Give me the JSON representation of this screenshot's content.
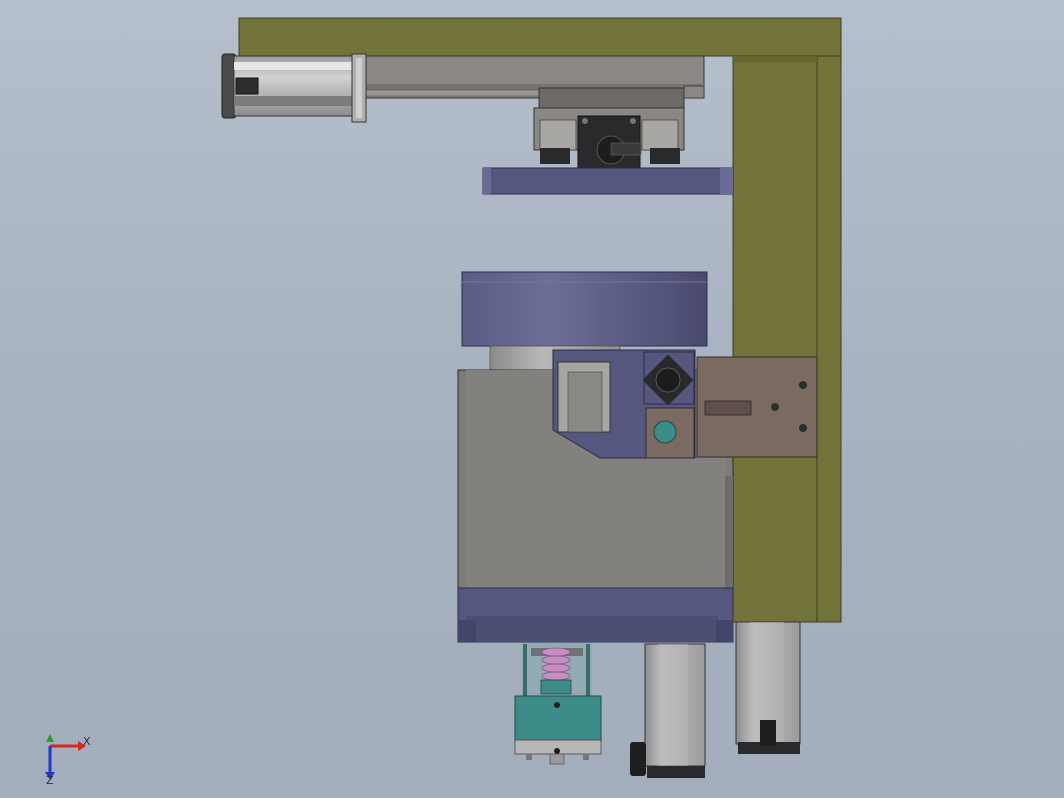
{
  "viewport": {
    "background_top": "#b6bfcc",
    "background_bottom": "#a3adbb"
  },
  "colors": {
    "frame_olive": "#727338",
    "frame_olive_dark": "#5f6030",
    "plate_blue": "#56577f",
    "plate_blue_dark": "#45466a",
    "body_gray": "#7d7b77",
    "motor_gray": "#a7a7a8",
    "teal": "#3c8c89",
    "bracket_brown": "#7a6a62",
    "spring_pink": "#c88fc4"
  },
  "triad": {
    "x_label": "X",
    "z_label": "Z",
    "x_color": "#d22a1f",
    "y_color": "#2aa12c",
    "z_color": "#2338c9"
  }
}
